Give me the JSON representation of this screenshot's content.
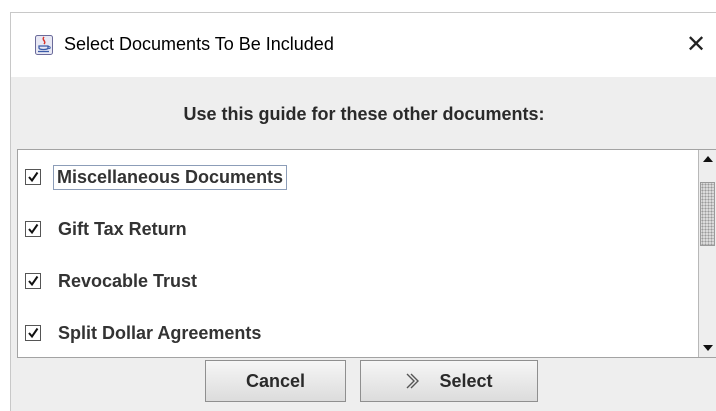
{
  "window": {
    "title": "Select Documents To Be Included",
    "close_glyph": "✕",
    "icon": "java-coffee-cup-icon"
  },
  "heading": "Use this guide for these other documents:",
  "documents": [
    {
      "label": "Miscellaneous Documents",
      "checked": true,
      "focused": true
    },
    {
      "label": "Gift Tax Return",
      "checked": true,
      "focused": false
    },
    {
      "label": "Revocable Trust",
      "checked": true,
      "focused": false
    },
    {
      "label": "Split Dollar Agreements",
      "checked": true,
      "focused": false
    }
  ],
  "buttons": {
    "cancel_label": "Cancel",
    "select_label": "Select",
    "select_icon": "double-chevron-right-icon"
  }
}
